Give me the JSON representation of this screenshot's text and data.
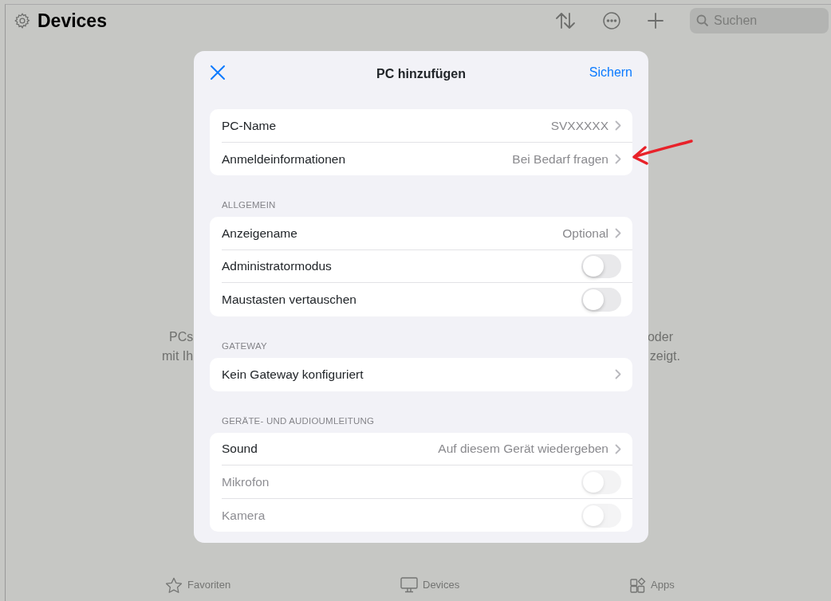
{
  "header": {
    "title": "Devices",
    "search": {
      "placeholder": "Suchen"
    }
  },
  "background_text": [
    {
      "left": "PCs",
      "right": "oder"
    },
    {
      "left": "mit Ih",
      "right": "zeigt."
    }
  ],
  "dialog": {
    "title": "PC hinzufügen",
    "save": "Sichern",
    "sections": [
      {
        "rows": [
          {
            "kind": "value",
            "label": "PC-Name",
            "value": "SVXXXXX"
          },
          {
            "kind": "value",
            "label": "Anmeldeinformationen",
            "value": "Bei Bedarf fragen"
          }
        ]
      },
      {
        "header": "ALLGEMEIN",
        "rows": [
          {
            "kind": "value",
            "label": "Anzeigename",
            "value": "Optional"
          },
          {
            "kind": "toggle",
            "label": "Administratormodus",
            "on": false,
            "disabled": false
          },
          {
            "kind": "toggle",
            "label": "Maustasten vertauschen",
            "on": false,
            "disabled": false
          }
        ]
      },
      {
        "header": "GATEWAY",
        "rows": [
          {
            "kind": "value",
            "label": "Kein Gateway konfiguriert",
            "value": null
          }
        ]
      },
      {
        "header": "GERÄTE- UND AUDIOUMLEITUNG",
        "rows": [
          {
            "kind": "value",
            "label": "Sound",
            "value": "Auf diesem Gerät wiedergeben"
          },
          {
            "kind": "toggle",
            "label": "Mikrofon",
            "on": false,
            "disabled": true
          },
          {
            "kind": "toggle",
            "label": "Kamera",
            "on": false,
            "disabled": true
          }
        ]
      }
    ]
  },
  "tabs": [
    {
      "label": "Favoriten",
      "selected": false
    },
    {
      "label": "Devices",
      "selected": false
    },
    {
      "label": "Apps",
      "selected": false
    }
  ]
}
